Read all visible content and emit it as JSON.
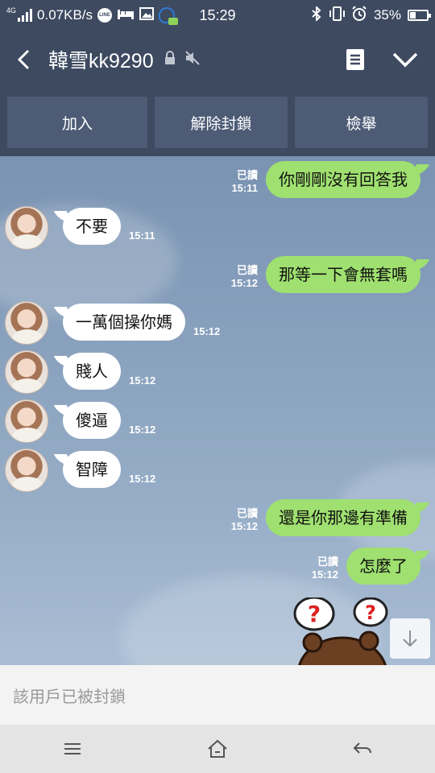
{
  "status_bar": {
    "network_type": "4G",
    "speed": "0.07KB/s",
    "time": "15:29",
    "battery_percent": "35%",
    "icons": [
      "signal-icon",
      "line-app-icon",
      "bed-icon",
      "image-icon",
      "mic-assistant-icon",
      "bluetooth-icon",
      "vibrate-icon",
      "alarm-icon",
      "battery-icon"
    ]
  },
  "header": {
    "title": "韓雪kk9290",
    "icons": [
      "back-icon",
      "lock-icon",
      "mute-icon",
      "notes-icon",
      "chevron-down-icon"
    ]
  },
  "actions": [
    {
      "label": "加入"
    },
    {
      "label": "解除封鎖"
    },
    {
      "label": "檢舉"
    }
  ],
  "messages": [
    {
      "dir": "out",
      "text": "你剛剛沒有回答我",
      "read": "已讀",
      "time": "15:11"
    },
    {
      "dir": "in",
      "text": "不要",
      "time": "15:11"
    },
    {
      "dir": "out",
      "text": "那等一下會無套嗎",
      "read": "已讀",
      "time": "15:12"
    },
    {
      "dir": "in",
      "text": "一萬個操你媽",
      "time": "15:12"
    },
    {
      "dir": "in",
      "text": "賤人",
      "time": "15:12"
    },
    {
      "dir": "in",
      "text": "傻逼",
      "time": "15:12"
    },
    {
      "dir": "in",
      "text": "智障",
      "time": "15:12"
    },
    {
      "dir": "out",
      "text": "還是你那邊有準備",
      "read": "已讀",
      "time": "15:12"
    },
    {
      "dir": "out",
      "text": "怎麼了",
      "read": "已讀",
      "time": "15:12"
    }
  ],
  "sticker": {
    "icon": "bear-question-sticker",
    "marks": [
      "?",
      "?"
    ]
  },
  "blocked_notice": "該用戶已被封鎖",
  "nav": [
    "menu-icon",
    "home-icon",
    "back-nav-icon"
  ],
  "colors": {
    "header_bg": "#3d4a60",
    "bubble_out": "#9fe070",
    "bubble_in": "#ffffff",
    "chat_bg": "#7f98b6"
  }
}
